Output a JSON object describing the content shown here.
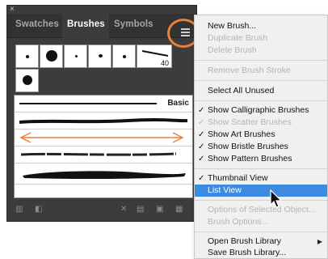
{
  "panel": {
    "close_glyph": "×",
    "tabs": [
      {
        "label": "Swatches",
        "active": false
      },
      {
        "label": "Brushes",
        "active": true
      },
      {
        "label": "Symbols",
        "active": false
      }
    ],
    "menu_icon": "panel-menu-icon",
    "brush_size_label": "40",
    "basic_label": "Basic",
    "footer_icons": [
      "brush-libraries-icon",
      "libraries-panel-icon",
      "remove-stroke-icon",
      "options-icon",
      "new-brush-icon",
      "delete-icon"
    ]
  },
  "menu": {
    "items": [
      {
        "label": "New Brush...",
        "disabled": false,
        "checked": false
      },
      {
        "label": "Duplicate Brush",
        "disabled": true,
        "checked": false
      },
      {
        "label": "Delete Brush",
        "disabled": true,
        "checked": false
      },
      {
        "label": "Remove Brush Stroke",
        "disabled": true,
        "checked": false
      },
      {
        "label": "Select All Unused",
        "disabled": false,
        "checked": false
      },
      {
        "label": "Show Calligraphic Brushes",
        "disabled": false,
        "checked": true
      },
      {
        "label": "Show Scatter Brushes",
        "disabled": true,
        "checked": true
      },
      {
        "label": "Show Art Brushes",
        "disabled": false,
        "checked": true
      },
      {
        "label": "Show Bristle Brushes",
        "disabled": false,
        "checked": true
      },
      {
        "label": "Show Pattern Brushes",
        "disabled": false,
        "checked": true
      },
      {
        "label": "Thumbnail View",
        "disabled": false,
        "checked": true
      },
      {
        "label": "List View",
        "disabled": false,
        "checked": false,
        "selected": true
      },
      {
        "label": "Options of Selected Object...",
        "disabled": true,
        "checked": false
      },
      {
        "label": "Brush Options...",
        "disabled": true,
        "checked": false
      },
      {
        "label": "Open Brush Library",
        "disabled": false,
        "checked": false,
        "submenu": true
      },
      {
        "label": "Save Brush Library...",
        "disabled": false,
        "checked": false
      }
    ],
    "check_glyph": "✓",
    "submenu_glyph": "▶"
  },
  "colors": {
    "panel_bg": "#3c3c3c",
    "highlight_ring": "#e8813a",
    "menu_selected": "#3c8be0",
    "arrow_brush": "#e8813a"
  }
}
